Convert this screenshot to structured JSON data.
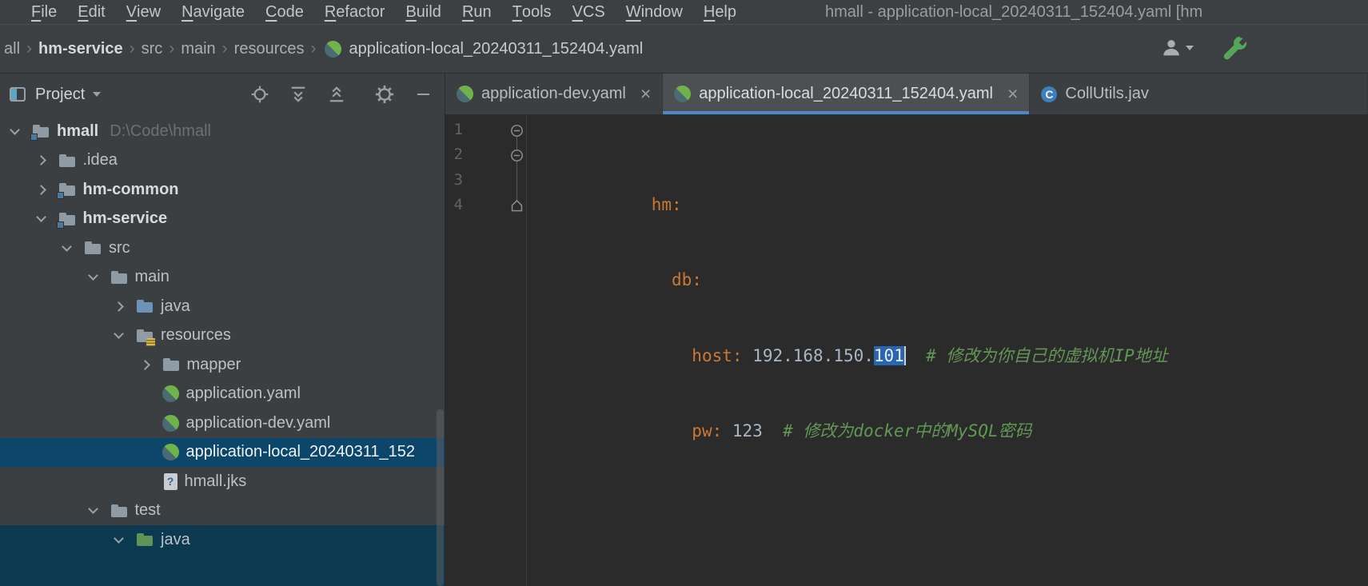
{
  "window": {
    "title": "hmall - application-local_20240311_152404.yaml [hm"
  },
  "menubar": {
    "items": [
      "File",
      "Edit",
      "View",
      "Navigate",
      "Code",
      "Refactor",
      "Build",
      "Run",
      "Tools",
      "VCS",
      "Window",
      "Help"
    ]
  },
  "navbar": {
    "crumbs": [
      "all",
      "hm-service",
      "src",
      "main",
      "resources"
    ],
    "separator": "›",
    "file": "application-local_20240311_152404.yaml"
  },
  "project_panel": {
    "title": "Project"
  },
  "tree": {
    "items": [
      {
        "label": "hmall",
        "hint": "D:\\Code\\hmall",
        "type": "project-root",
        "expanded": true
      },
      {
        "label": ".idea",
        "type": "folder",
        "expanded": false
      },
      {
        "label": "hm-common",
        "type": "module",
        "expanded": false
      },
      {
        "label": "hm-service",
        "type": "module",
        "expanded": true
      },
      {
        "label": "src",
        "type": "folder",
        "expanded": true
      },
      {
        "label": "main",
        "type": "folder",
        "expanded": true
      },
      {
        "label": "java",
        "type": "source-folder",
        "expanded": false
      },
      {
        "label": "resources",
        "type": "resources-folder",
        "expanded": true
      },
      {
        "label": "mapper",
        "type": "folder",
        "expanded": false
      },
      {
        "label": "application.yaml",
        "type": "spring-config-file"
      },
      {
        "label": "application-dev.yaml",
        "type": "spring-config-file"
      },
      {
        "label": "application-local_20240311_152",
        "type": "spring-config-file",
        "selected": true
      },
      {
        "label": "hmall.jks",
        "type": "unknown-file"
      },
      {
        "label": "test",
        "type": "folder",
        "expanded": true
      },
      {
        "label": "java",
        "type": "test-source-folder",
        "expanded": true
      }
    ]
  },
  "tabs": {
    "close_glyph": "×",
    "items": [
      {
        "label": "application-dev.yaml",
        "icon": "spring-config",
        "active": false
      },
      {
        "label": "application-local_20240311_152404.yaml",
        "icon": "spring-config",
        "active": true
      },
      {
        "label": "CollUtils.jav",
        "icon": "java-class",
        "active": false
      }
    ]
  },
  "editor": {
    "line_numbers": [
      "1",
      "2",
      "3",
      "4"
    ],
    "lines": [
      {
        "tokens": [
          {
            "text": "hm:",
            "type": "key"
          }
        ]
      },
      {
        "tokens": [
          {
            "text": "  ",
            "type": "plain"
          },
          {
            "text": "db:",
            "type": "key"
          }
        ]
      },
      {
        "tokens": [
          {
            "text": "    ",
            "type": "plain"
          },
          {
            "text": "host:",
            "type": "key"
          },
          {
            "text": " ",
            "type": "plain"
          },
          {
            "text": "192.168.150.",
            "type": "value"
          },
          {
            "text": "101",
            "type": "value-selected"
          },
          {
            "text": "  ",
            "type": "plain"
          },
          {
            "text": "# 修改为你自己的虚拟机IP地址",
            "type": "comment"
          }
        ]
      },
      {
        "tokens": [
          {
            "text": "    ",
            "type": "plain"
          },
          {
            "text": "pw:",
            "type": "key"
          },
          {
            "text": " ",
            "type": "plain"
          },
          {
            "text": "123",
            "type": "value"
          },
          {
            "text": "  ",
            "type": "plain"
          },
          {
            "text": "# 修改为docker中的MySQL密码",
            "type": "comment"
          }
        ]
      }
    ]
  },
  "icons": {
    "java_class_letter": "C",
    "unknown_file_glyph": "?"
  },
  "colors": {
    "panel_bg": "#3c3f41",
    "editor_bg": "#2b2b2b",
    "tree_selection": "#0d466b",
    "editor_selection": "#2965b5",
    "tab_underline": "#4a88c7",
    "yaml_key": "#cc7832",
    "comment_green": "#629755",
    "spring_green": "#6fb34a"
  }
}
